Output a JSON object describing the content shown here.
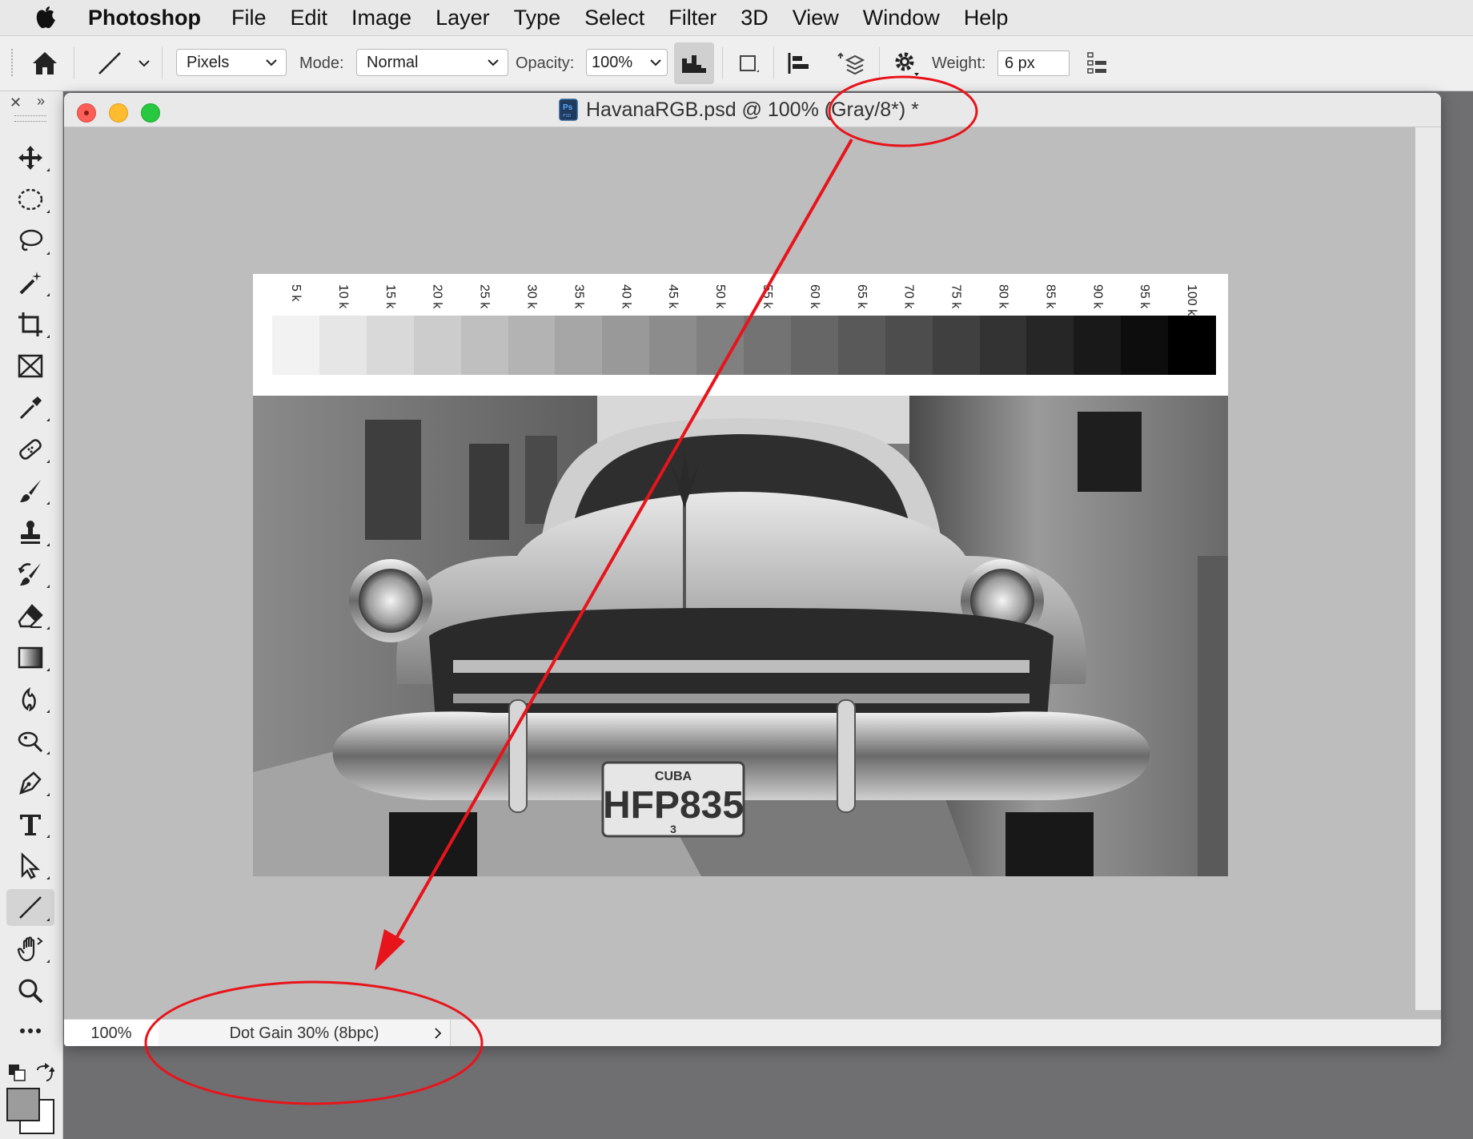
{
  "menubar": {
    "app_name": "Photoshop",
    "items": [
      "File",
      "Edit",
      "Image",
      "Layer",
      "Type",
      "Select",
      "Filter",
      "3D",
      "View",
      "Window",
      "Help"
    ]
  },
  "options": {
    "tool_icon": "line-tool-icon",
    "fill_type": "Pixels",
    "mode_label": "Mode:",
    "mode_value": "Normal",
    "opacity_label": "Opacity:",
    "opacity_value": "100%",
    "weight_label": "Weight:",
    "weight_value": "6 px"
  },
  "toolbar": {
    "tools": [
      "move-tool-icon",
      "elliptical-marquee-icon",
      "lasso-icon",
      "magic-wand-icon",
      "crop-icon",
      "frame-icon",
      "eyedropper-icon",
      "healing-brush-icon",
      "brush-icon",
      "clone-stamp-icon",
      "history-brush-icon",
      "eraser-icon",
      "gradient-icon",
      "blur-icon",
      "dodge-icon",
      "pen-icon",
      "type-icon",
      "path-selection-icon",
      "line-tool-icon",
      "hand-icon",
      "zoom-icon",
      "more-tools-icon"
    ],
    "active_tool": "line-tool-icon"
  },
  "document": {
    "title": "HavanaRGB.psd @ 100% (Gray/8*) *",
    "zoom": "100%",
    "doc_info": "Dot Gain 30% (8bpc)",
    "license_plate_top": "CUBA",
    "license_plate": "HFP835",
    "license_plate_bottom": "3"
  },
  "grayscale_chart": {
    "labels": [
      "5 k",
      "10 k",
      "15 k",
      "20 k",
      "25 k",
      "30 k",
      "35 k",
      "40 k",
      "45 k",
      "50 k",
      "55 k",
      "60 k",
      "65 k",
      "70 k",
      "75 k",
      "80 k",
      "85 k",
      "90 k",
      "95 k",
      "100 k"
    ],
    "k_values": [
      5,
      10,
      15,
      20,
      25,
      30,
      35,
      40,
      45,
      50,
      55,
      60,
      65,
      70,
      75,
      80,
      85,
      90,
      95,
      100
    ]
  },
  "annotation_color": "#e8141b"
}
